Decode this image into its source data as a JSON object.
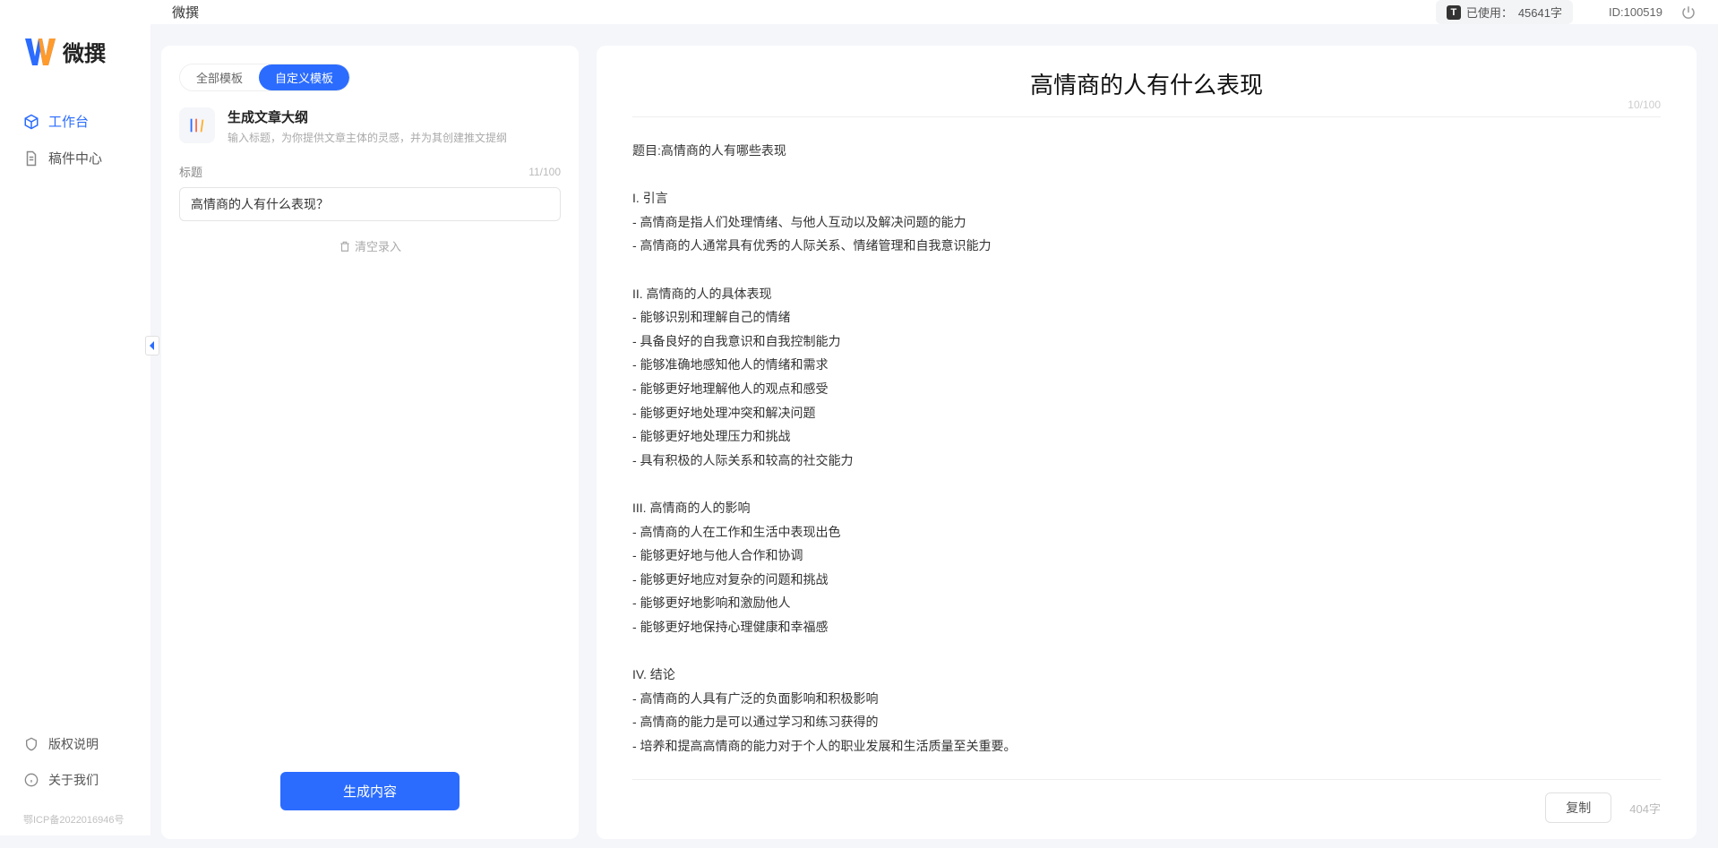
{
  "brand": {
    "name": "微撰"
  },
  "sidebar": {
    "items": [
      {
        "label": "工作台",
        "icon": "cube"
      },
      {
        "label": "稿件中心",
        "icon": "doc"
      }
    ],
    "bottom": [
      {
        "label": "版权说明",
        "icon": "shield"
      },
      {
        "label": "关于我们",
        "icon": "info"
      }
    ],
    "icp": "鄂ICP备2022016946号"
  },
  "topbar": {
    "title": "微撰",
    "usage_label": "已使用：",
    "usage_value": "45641字",
    "id_label": "ID:",
    "id_value": "100519"
  },
  "left_panel": {
    "tabs": [
      {
        "label": "全部模板",
        "active": false
      },
      {
        "label": "自定义模板",
        "active": true
      }
    ],
    "template": {
      "title": "生成文章大纲",
      "desc": "输入标题，为你提供文章主体的灵感，并为其创建推文提纲"
    },
    "form": {
      "label": "标题",
      "value": "高情商的人有什么表现？",
      "count": "11/100"
    },
    "clear_label": "清空录入",
    "generate_label": "生成内容"
  },
  "right_panel": {
    "title": "高情商的人有什么表现",
    "title_count": "10/100",
    "body": "题目:高情商的人有哪些表现\n\nI. 引言\n- 高情商是指人们处理情绪、与他人互动以及解决问题的能力\n- 高情商的人通常具有优秀的人际关系、情绪管理和自我意识能力\n\nII. 高情商的人的具体表现\n- 能够识别和理解自己的情绪\n- 具备良好的自我意识和自我控制能力\n- 能够准确地感知他人的情绪和需求\n- 能够更好地理解他人的观点和感受\n- 能够更好地处理冲突和解决问题\n- 能够更好地处理压力和挑战\n- 具有积极的人际关系和较高的社交能力\n\nIII. 高情商的人的影响\n- 高情商的人在工作和生活中表现出色\n- 能够更好地与他人合作和协调\n- 能够更好地应对复杂的问题和挑战\n- 能够更好地影响和激励他人\n- 能够更好地保持心理健康和幸福感\n\nIV. 结论\n- 高情商的人具有广泛的负面影响和积极影响\n- 高情商的能力是可以通过学习和练习获得的\n- 培养和提高高情商的能力对于个人的职业发展和生活质量至关重要。",
    "copy_label": "复制",
    "word_count": "404字"
  }
}
